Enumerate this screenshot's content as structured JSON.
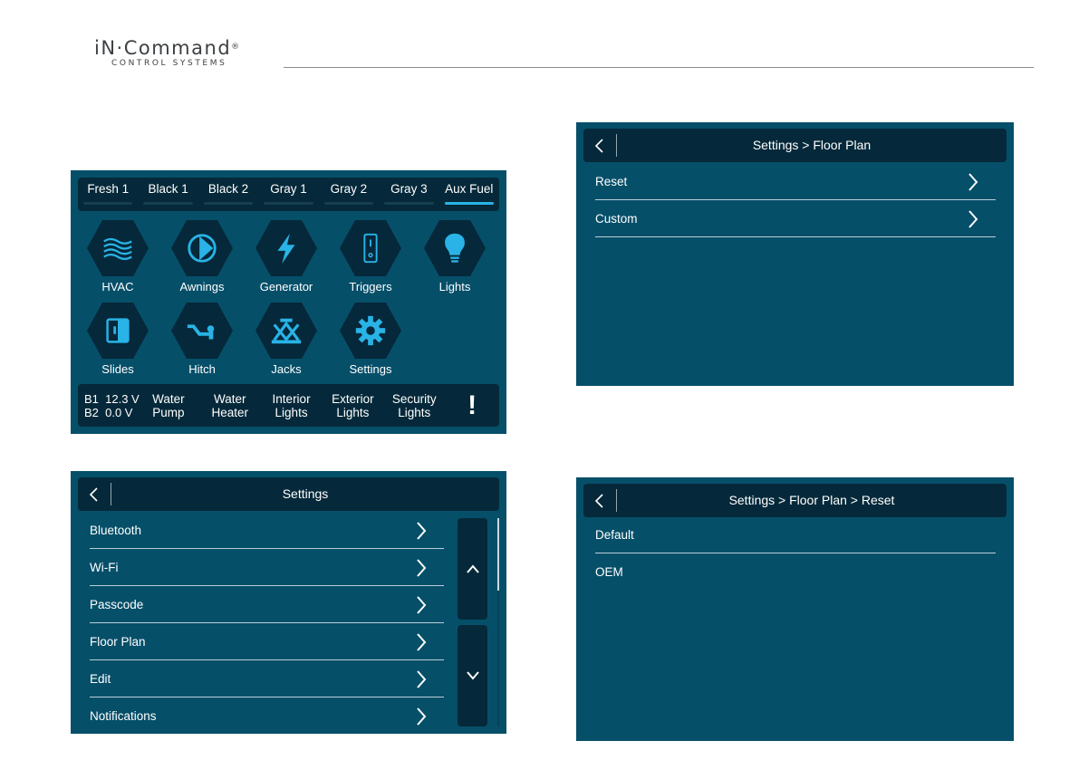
{
  "brand": {
    "name": "iN·Command",
    "registered": "®",
    "tagline": "CONTROL SYSTEMS"
  },
  "home": {
    "tabs": [
      {
        "label": "Fresh 1",
        "active": false
      },
      {
        "label": "Black 1",
        "active": false
      },
      {
        "label": "Black 2",
        "active": false
      },
      {
        "label": "Gray 1",
        "active": false
      },
      {
        "label": "Gray 2",
        "active": false
      },
      {
        "label": "Gray 3",
        "active": false
      },
      {
        "label": "Aux Fuel",
        "active": true
      }
    ],
    "apps": [
      {
        "label": "HVAC",
        "icon": "hvac-waves-icon"
      },
      {
        "label": "Awnings",
        "icon": "awning-icon"
      },
      {
        "label": "Generator",
        "icon": "lightning-bolt-icon"
      },
      {
        "label": "Triggers",
        "icon": "switch-icon"
      },
      {
        "label": "Lights",
        "icon": "lightbulb-icon"
      },
      {
        "label": "Slides",
        "icon": "slide-out-icon"
      },
      {
        "label": "Hitch",
        "icon": "hitch-icon"
      },
      {
        "label": "Jacks",
        "icon": "scissor-jack-icon"
      },
      {
        "label": "Settings",
        "icon": "gear-icon"
      }
    ],
    "status": {
      "b1": "B1  12.3 V",
      "b2": "B2  0.0 V",
      "quick": [
        {
          "line1": "Water",
          "line2": "Pump"
        },
        {
          "line1": "Water",
          "line2": "Heater"
        },
        {
          "line1": "Interior",
          "line2": "Lights"
        },
        {
          "line1": "Exterior",
          "line2": "Lights"
        },
        {
          "line1": "Security",
          "line2": "Lights"
        }
      ],
      "alert": "!"
    }
  },
  "settings": {
    "title": "Settings",
    "items": [
      {
        "label": "Bluetooth"
      },
      {
        "label": "Wi-Fi"
      },
      {
        "label": "Passcode"
      },
      {
        "label": "Floor Plan"
      },
      {
        "label": "Edit"
      },
      {
        "label": "Notifications"
      }
    ]
  },
  "floorplan": {
    "title": "Settings > Floor Plan",
    "items": [
      {
        "label": "Reset"
      },
      {
        "label": "Custom"
      }
    ]
  },
  "reset": {
    "title": "Settings > Floor Plan > Reset",
    "items": [
      {
        "label": "Default"
      },
      {
        "label": "OEM"
      }
    ]
  },
  "colors": {
    "screen_bg": "#064f69",
    "bar_bg": "#05293a",
    "accent": "#29b3e6",
    "icon": "#29b3e6"
  }
}
